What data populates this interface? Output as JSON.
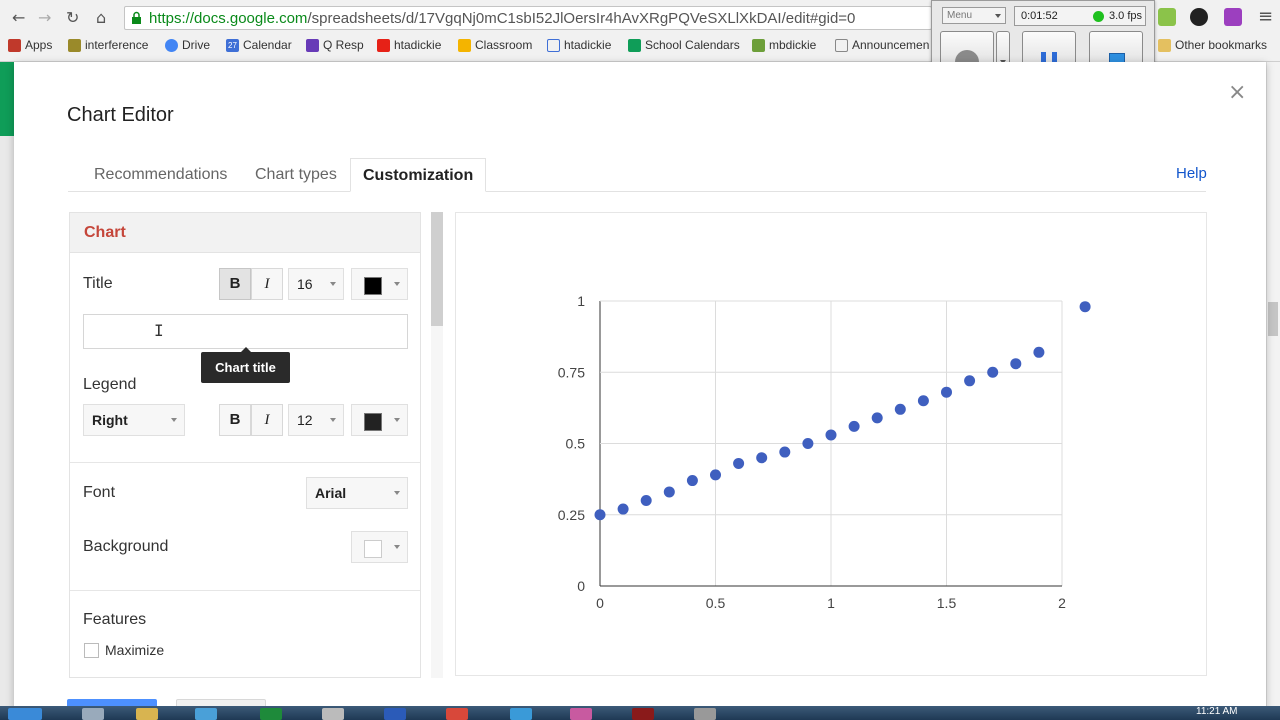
{
  "browser": {
    "url_host": "https://docs.google.com",
    "url_path": "/spreadsheets/d/17VgqNj0mC1sbI52JlOersIr4hAvXRgPQVeSXLlXkDAI/edit#gid=0",
    "bookmarks": [
      "Apps",
      "interference",
      "Drive",
      "Calendar",
      "Q Resp",
      "htadickie",
      "Classroom",
      "htadickie",
      "School Calendars",
      "mbdickie",
      "Announcemen"
    ],
    "other_bookmarks": "Other bookmarks",
    "calendar_badge": "27"
  },
  "recorder": {
    "menu_label": "Menu",
    "time": "0:01:52",
    "fps": "3.0 fps"
  },
  "dialog": {
    "title": "Chart Editor",
    "close": "×",
    "tabs": [
      "Recommendations",
      "Chart types",
      "Customization"
    ],
    "active_tab": "Customization",
    "help": "Help"
  },
  "panel": {
    "section": "Chart",
    "title_label": "Title",
    "bold": "B",
    "italic": "I",
    "title_font_size": "16",
    "title_color": "#000000",
    "title_value": "",
    "cursor": "I",
    "tooltip": "Chart title",
    "legend_label": "Legend",
    "legend_position": "Right",
    "legend_font_size": "12",
    "legend_color": "#222222",
    "font_label": "Font",
    "font_value": "Arial",
    "background_label": "Background",
    "background_color": "#ffffff",
    "features_label": "Features",
    "maximize_label": "Maximize",
    "maximize_checked": false
  },
  "chart_data": {
    "type": "scatter",
    "x": [
      0,
      0.1,
      0.2,
      0.3,
      0.4,
      0.5,
      0.6,
      0.7,
      0.8,
      0.9,
      1.0,
      1.1,
      1.2,
      1.3,
      1.4,
      1.5,
      1.6,
      1.7,
      1.8,
      1.9,
      2.1
    ],
    "y": [
      0.25,
      0.27,
      0.3,
      0.33,
      0.37,
      0.39,
      0.43,
      0.45,
      0.47,
      0.5,
      0.53,
      0.56,
      0.59,
      0.62,
      0.65,
      0.68,
      0.72,
      0.75,
      0.78,
      0.82,
      0.98
    ],
    "xlim": [
      0,
      2
    ],
    "ylim": [
      0,
      1
    ],
    "x_ticks": [
      "0",
      "0.5",
      "1",
      "1.5",
      "2"
    ],
    "y_ticks": [
      "0",
      "0.25",
      "0.5",
      "0.75",
      "1"
    ],
    "grid": true,
    "point_color": "#3f5fbf"
  },
  "taskbar": {
    "clock": "11:21 AM"
  }
}
